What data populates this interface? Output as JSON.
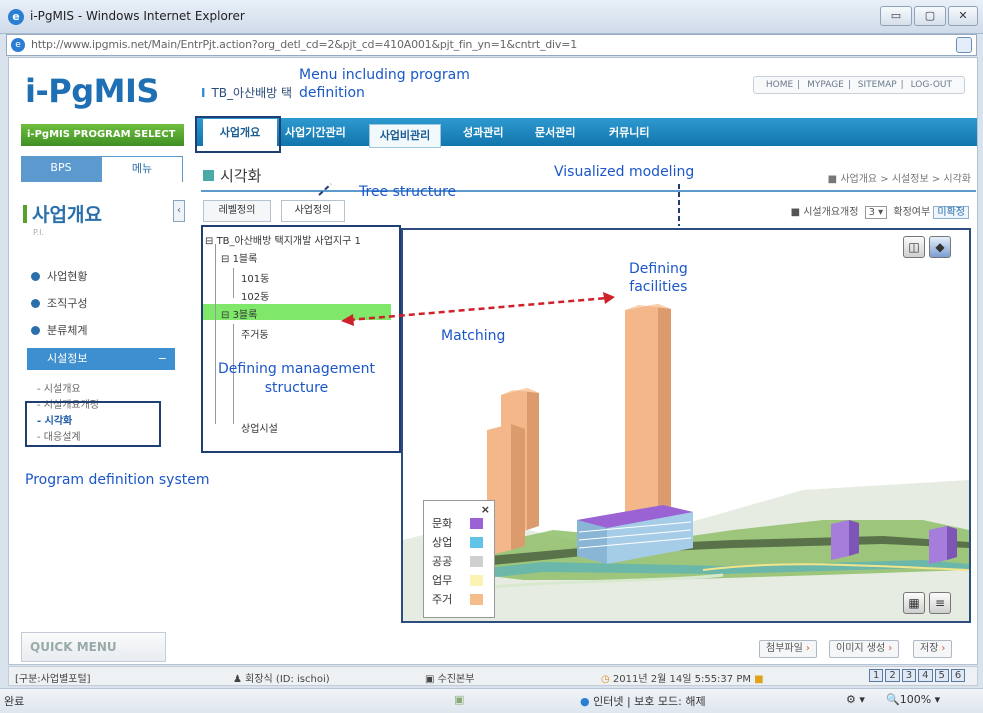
{
  "window": {
    "title": "i-PgMIS - Windows Internet Explorer",
    "controls": [
      "▭",
      "▢",
      "✕"
    ]
  },
  "address": {
    "url": "http://www.ipgmis.net/Main/EntrPjt.action?org_detl_cd=2&pjt_cd=410A001&pjt_fin_yn=1&cntrt_div=1"
  },
  "header": {
    "logo_main": "i-PgMIS",
    "program_select": "i-PgMIS PROGRAM SELECT",
    "project_name": "TB_아산배방 택",
    "links": [
      "HOME",
      "MYPAGE",
      "SITEMAP",
      "LOG-OUT"
    ]
  },
  "nav": {
    "active": "사업개요",
    "items": [
      "사업기간관리",
      "사업비관리",
      "성과관리",
      "문서관리",
      "커뮤니티"
    ]
  },
  "sidebar": {
    "tabs": [
      "BPS",
      "메뉴"
    ],
    "title": "사업개요",
    "subtitle": "P.I.",
    "items": [
      "사업현황",
      "조직구성",
      "분류체계"
    ],
    "section": "시설정보",
    "section_toggle": "−",
    "sub_items": [
      "시설개요",
      "시설개요개정",
      "시각화",
      "대응설계"
    ],
    "quick_menu": "QUICK MENU"
  },
  "content": {
    "title": "시각화",
    "breadcrumb": "사업개요 > 시설정보 > 시각화",
    "tabs": [
      "레벨정의",
      "사업정의"
    ],
    "revision_label": "시설개요개정",
    "revision_value": "3",
    "confirm_label": "확정여부",
    "confirm_value": "미확정"
  },
  "tree": {
    "root": "TB_아산배방 택지개발 사업지구 1",
    "nodes": [
      {
        "label": "1블록",
        "level": 1
      },
      {
        "label": "101동",
        "level": 2
      },
      {
        "label": "102동",
        "level": 2
      },
      {
        "label": "3블록",
        "level": 1,
        "selected": true
      },
      {
        "label": "주거동",
        "level": 2
      },
      {
        "label": "상업시설",
        "level": 2
      }
    ]
  },
  "legend": {
    "close": "×",
    "items": [
      {
        "label": "문화",
        "color": "#9b62d4"
      },
      {
        "label": "상업",
        "color": "#61c3e8"
      },
      {
        "label": "공공",
        "color": "#cfcfcf"
      },
      {
        "label": "업무",
        "color": "#fbf3b4"
      },
      {
        "label": "주거",
        "color": "#f5bd8a"
      }
    ]
  },
  "actions": [
    "첨부파일",
    "이미지 생성",
    "저장"
  ],
  "status1": {
    "left": "[구분:사업별포털]",
    "user": "회장식 (ID: ischoi)",
    "dept": "수진본부",
    "datetime": "2011년 2월 14일 5:55:37 PM",
    "pages": [
      "1",
      "2",
      "3",
      "4",
      "5",
      "6"
    ]
  },
  "status2": {
    "done": "완료",
    "zone": "인터넷 | 보호 모드: 해제",
    "zoom": "100%"
  },
  "annotations": {
    "menu": "Menu including program\ndefinition",
    "tree": "Tree structure",
    "visualized": "Visualized modeling",
    "defining_facilities": "Defining\nfacilities",
    "matching": "Matching",
    "mgmt": "Defining management\nstructure",
    "program_def": "Program definition system"
  }
}
